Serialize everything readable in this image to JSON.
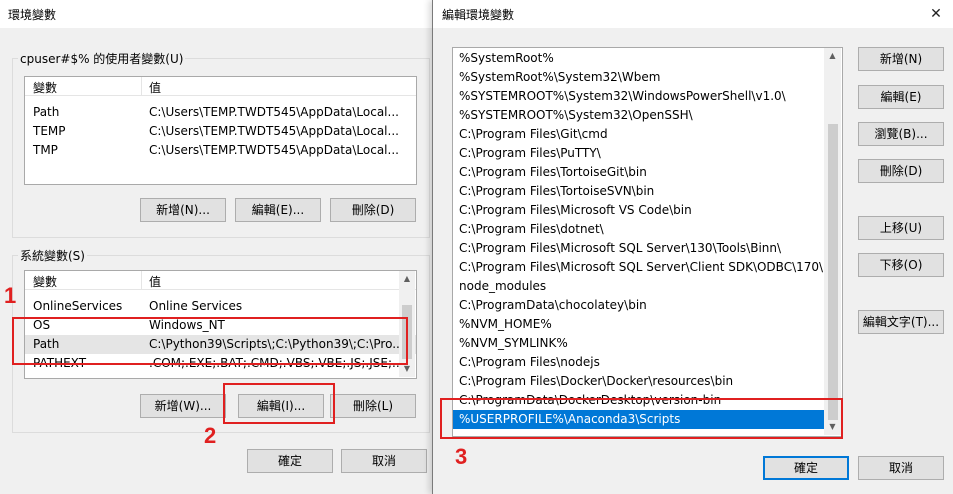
{
  "left_dialog": {
    "title": "環境變數",
    "user_group_label": "cpuser#$% 的使用者變數(U)",
    "col_variable": "變數",
    "col_value": "值",
    "user_vars": [
      {
        "name": "Path",
        "value": "C:\\Users\\TEMP.TWDT545\\AppData\\Local..."
      },
      {
        "name": "TEMP",
        "value": "C:\\Users\\TEMP.TWDT545\\AppData\\Local..."
      },
      {
        "name": "TMP",
        "value": "C:\\Users\\TEMP.TWDT545\\AppData\\Local..."
      }
    ],
    "user_buttons": {
      "new": "新增(N)...",
      "edit": "編輯(E)...",
      "delete": "刪除(D)"
    },
    "system_group_label": "系統變數(S)",
    "system_vars": [
      {
        "name": "OnlineServices",
        "value": "Online Services"
      },
      {
        "name": "OS",
        "value": "Windows_NT"
      },
      {
        "name": "Path",
        "value": "C:\\Python39\\Scripts\\;C:\\Python39\\;C:\\Pro..."
      },
      {
        "name": "PATHEXT",
        "value": ".COM;.EXE;.BAT;.CMD;.VBS;.VBE;.JS;.JSE;..."
      }
    ],
    "system_buttons": {
      "new": "新增(W)...",
      "edit": "編輯(I)...",
      "delete": "刪除(L)"
    },
    "ok": "確定",
    "cancel": "取消"
  },
  "right_dialog": {
    "title": "編輯環境變數",
    "close": "✕",
    "path_entries": [
      "%SystemRoot%",
      "%SystemRoot%\\System32\\Wbem",
      "%SYSTEMROOT%\\System32\\WindowsPowerShell\\v1.0\\",
      "%SYSTEMROOT%\\System32\\OpenSSH\\",
      "C:\\Program Files\\Git\\cmd",
      "C:\\Program Files\\PuTTY\\",
      "C:\\Program Files\\TortoiseGit\\bin",
      "C:\\Program Files\\TortoiseSVN\\bin",
      "C:\\Program Files\\Microsoft VS Code\\bin",
      "C:\\Program Files\\dotnet\\",
      "C:\\Program Files\\Microsoft SQL Server\\130\\Tools\\Binn\\",
      "C:\\Program Files\\Microsoft SQL Server\\Client SDK\\ODBC\\170\\...",
      "node_modules",
      "C:\\ProgramData\\chocolatey\\bin",
      "%NVM_HOME%",
      "%NVM_SYMLINK%",
      "C:\\Program Files\\nodejs",
      "C:\\Program Files\\Docker\\Docker\\resources\\bin",
      "C:\\ProgramData\\DockerDesktop\\version-bin",
      "%USERPROFILE%\\Anaconda3\\Scripts"
    ],
    "selected_index": 19,
    "buttons": {
      "new": "新增(N)",
      "edit": "編輯(E)",
      "browse": "瀏覽(B)...",
      "delete": "刪除(D)",
      "move_up": "上移(U)",
      "move_down": "下移(O)",
      "edit_text": "編輯文字(T)..."
    },
    "ok": "確定",
    "cancel": "取消"
  },
  "annotations": {
    "one": "1",
    "two": "2",
    "three": "3"
  },
  "colors": {
    "highlight": "#e02020",
    "selection": "#0078d7"
  }
}
